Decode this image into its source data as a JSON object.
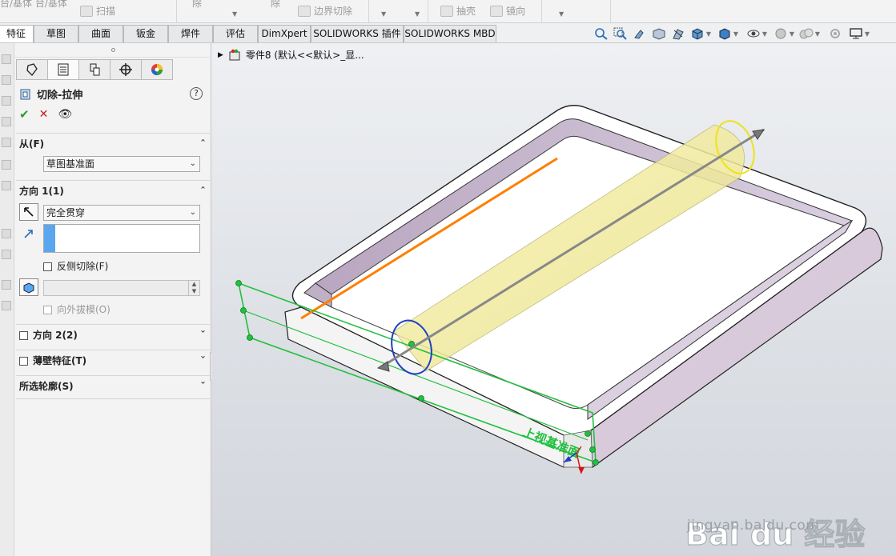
{
  "ribbon": {
    "item_left": "台/基体   台/基体",
    "scan_label": "扫描",
    "remove_1": "除",
    "remove_2": "除",
    "boundary_cut": "边界切除",
    "shell": "抽壳",
    "mirror": "镜向"
  },
  "tabs": [
    {
      "label": "特征",
      "active": true
    },
    {
      "label": "草图",
      "active": false
    },
    {
      "label": "曲面",
      "active": false
    },
    {
      "label": "钣金",
      "active": false
    },
    {
      "label": "焊件",
      "active": false
    },
    {
      "label": "评估",
      "active": false
    },
    {
      "label": "DimXpert",
      "active": false
    },
    {
      "label": "SOLIDWORKS 插件",
      "active": false
    },
    {
      "label": "SOLIDWORKS MBD",
      "active": false
    }
  ],
  "property_manager": {
    "title": "切除-拉伸",
    "help": "?",
    "from_section": {
      "label": "从(F)",
      "value": "草图基准面"
    },
    "direction1": {
      "label": "方向 1(1)",
      "end_condition": "完全贯穿",
      "flip_cut": "反侧切除(F)",
      "draft_outward": "向外拔模(O)"
    },
    "direction2": {
      "label": "方向 2(2)"
    },
    "thin_feature": {
      "label": "薄壁特征(T)"
    },
    "selected_contours": {
      "label": "所选轮廓(S)"
    }
  },
  "viewport": {
    "tree_label": "零件8 (默认<<默认>_显...",
    "plane_label": "上视基准面"
  },
  "watermark": {
    "brand": "Bai du 经验",
    "url": "jingyan.baidu.com"
  },
  "colors": {
    "accent_blue": "#5aa7ef",
    "sketch_green": "#22c040",
    "edge_orange": "#ff7f00",
    "cylinder_yellow": "#f6f2a0",
    "wall_lavender": "#cdbfd2"
  }
}
